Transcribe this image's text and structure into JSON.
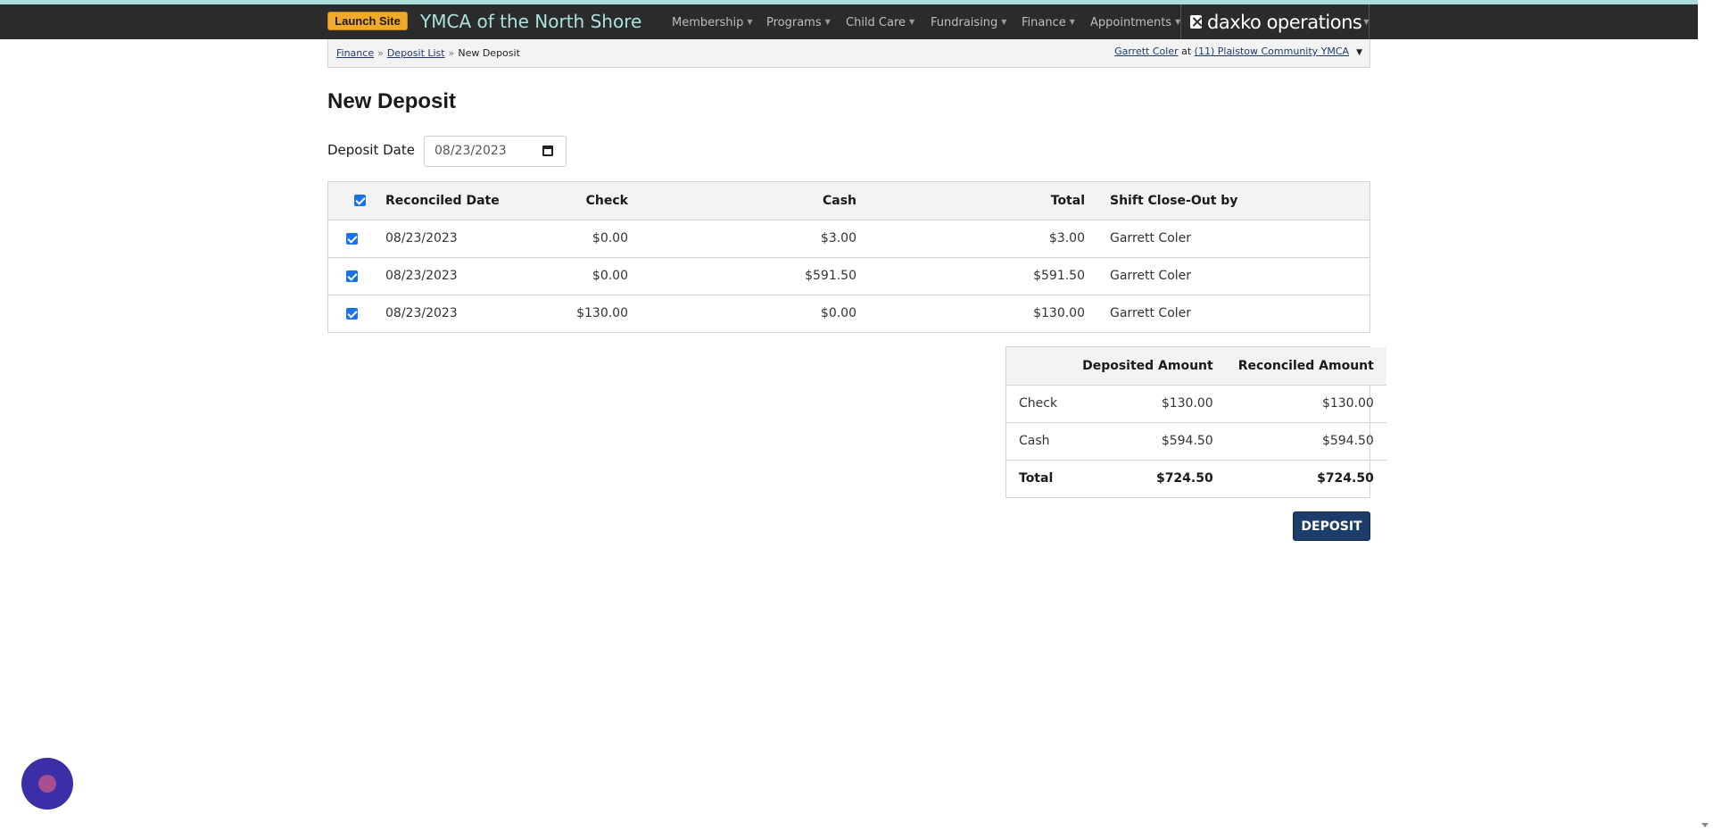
{
  "navbar": {
    "launch_label": "Launch Site",
    "org_name": "YMCA of the North Shore",
    "menu": [
      "Membership",
      "Programs",
      "Child Care",
      "Fundraising",
      "Finance",
      "Appointments"
    ],
    "brand": "daxko operations"
  },
  "breadcrumb": {
    "finance": "Finance",
    "deposit_list": "Deposit List",
    "current": "New Deposit",
    "separator": "»"
  },
  "user": {
    "name": "Garrett Coler",
    "at": "at",
    "location": "(11) Plaistow Community YMCA"
  },
  "page": {
    "title": "New Deposit",
    "deposit_date_label": "Deposit Date",
    "deposit_date_value": "08/23/2023"
  },
  "shifts": {
    "headers": [
      "Reconciled Date",
      "Check",
      "Cash",
      "Total",
      "Shift Close-Out by"
    ],
    "rows": [
      {
        "date": "08/23/2023",
        "check": "$0.00",
        "cash": "$3.00",
        "total": "$3.00",
        "by": "Garrett Coler",
        "checked": true
      },
      {
        "date": "08/23/2023",
        "check": "$0.00",
        "cash": "$591.50",
        "total": "$591.50",
        "by": "Garrett Coler",
        "checked": true
      },
      {
        "date": "08/23/2023",
        "check": "$130.00",
        "cash": "$0.00",
        "total": "$130.00",
        "by": "Garrett Coler",
        "checked": true
      }
    ]
  },
  "summary": {
    "headers": [
      "",
      "Deposited Amount",
      "Reconciled Amount"
    ],
    "rows": [
      {
        "label": "Check",
        "deposited": "$130.00",
        "reconciled": "$130.00"
      },
      {
        "label": "Cash",
        "deposited": "$594.50",
        "reconciled": "$594.50"
      },
      {
        "label": "Total",
        "deposited": "$724.50",
        "reconciled": "$724.50"
      }
    ]
  },
  "actions": {
    "deposit_label": "DEPOSIT"
  },
  "icons": {
    "calendar": "calendar-icon",
    "chat": "chat-widget-icon",
    "brand_logo": "daxko-x-icon"
  }
}
